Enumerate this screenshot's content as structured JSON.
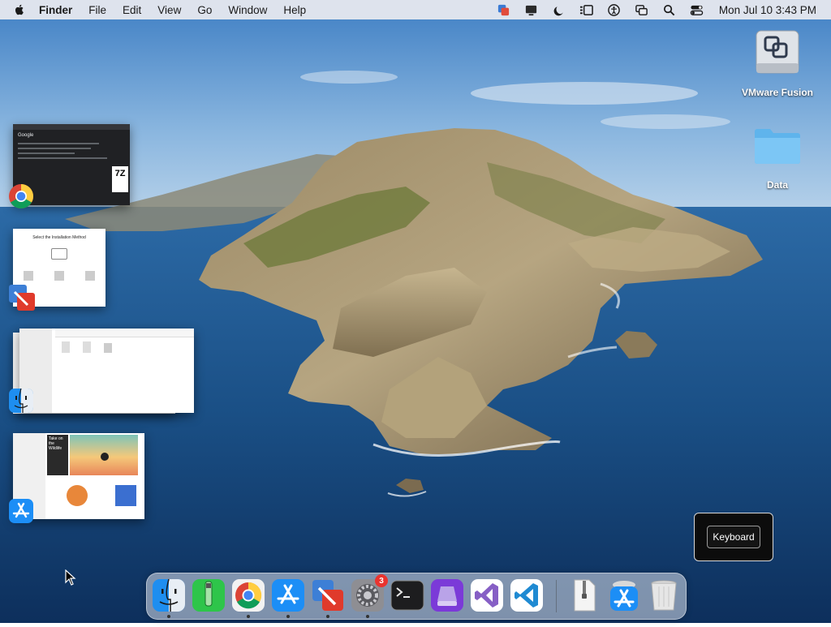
{
  "menubar": {
    "app_name": "Finder",
    "menus": [
      "File",
      "Edit",
      "View",
      "Go",
      "Window",
      "Help"
    ],
    "clock": "Mon Jul 10  3:43 PM",
    "status_icons": [
      "vmware-status-icon",
      "display-icon",
      "moon-focus-icon",
      "stage-manager-icon",
      "accessibility-icon",
      "screen-mirroring-icon",
      "spotlight-search-icon",
      "control-center-icon"
    ]
  },
  "desktop": {
    "icons": [
      {
        "label": "VMware Fusion",
        "icon": "vmware-fusion-drive-icon"
      },
      {
        "label": "Data",
        "icon": "folder-icon"
      }
    ]
  },
  "stage_manager": {
    "groups": [
      {
        "app": "Google Chrome",
        "icon": "chrome-icon",
        "thumb_text": "Google",
        "thumb_badge": "7Z"
      },
      {
        "app": "VMware Fusion",
        "icon": "vmware-fusion-icon",
        "thumb_text": "Select the Installation Method"
      },
      {
        "app": "Finder",
        "icon": "finder-icon"
      },
      {
        "app": "App Store",
        "icon": "app-store-icon",
        "thumb_text": "Take on the Wildlife"
      }
    ]
  },
  "keyboard_popup": {
    "label": "Keyboard"
  },
  "dock": {
    "apps": [
      {
        "name": "Finder",
        "icon": "finder-icon",
        "running": true
      },
      {
        "name": "Script Editor",
        "icon": "script-editor-icon",
        "running": false
      },
      {
        "name": "Google Chrome",
        "icon": "chrome-icon",
        "running": true
      },
      {
        "name": "App Store",
        "icon": "app-store-icon",
        "running": true
      },
      {
        "name": "VMware Fusion",
        "icon": "vmware-fusion-icon",
        "running": true
      },
      {
        "name": "System Settings",
        "icon": "system-settings-icon",
        "running": true,
        "badge": "3"
      },
      {
        "name": "Terminal",
        "icon": "terminal-icon",
        "running": false
      },
      {
        "name": "Disk Utility",
        "icon": "disk-utility-icon",
        "running": false
      },
      {
        "name": "Visual Studio",
        "icon": "visual-studio-icon",
        "running": false
      },
      {
        "name": "Visual Studio Code",
        "icon": "vscode-icon",
        "running": false
      }
    ],
    "others": [
      {
        "name": "Downloads",
        "icon": "archive-file-icon"
      },
      {
        "name": "App Store Installer",
        "icon": "app-store-installer-icon"
      },
      {
        "name": "Trash",
        "icon": "trash-icon"
      }
    ]
  },
  "colors": {
    "menubar": "#ececf0",
    "sea": "#1d4f86",
    "sky": "#6fa4d6",
    "dock_badge": "#e9342f"
  }
}
